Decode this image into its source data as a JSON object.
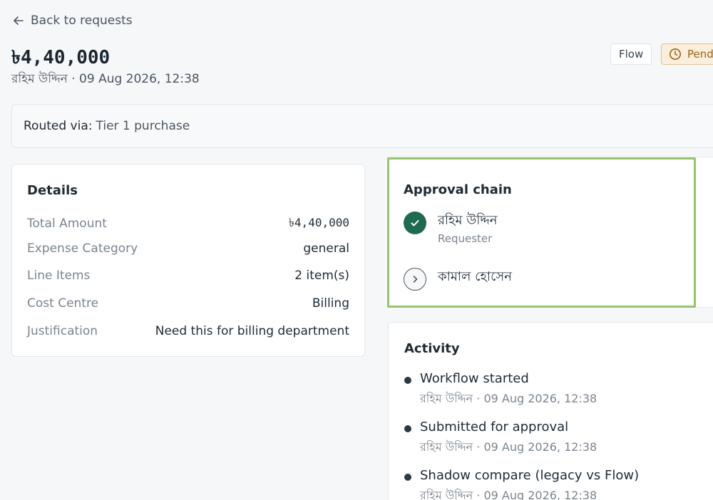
{
  "nav": {
    "back_label": "Back to requests"
  },
  "header": {
    "amount": "৳4,40,000",
    "meta": "রহিম উদ্দিন · 09 Aug 2026, 12:38",
    "tags": {
      "flow": "Flow",
      "status": "Pend"
    }
  },
  "routing": {
    "label": "Routed via:",
    "value": "Tier 1 purchase"
  },
  "details": {
    "title": "Details",
    "rows": [
      {
        "label": "Total Amount",
        "value": "৳4,40,000"
      },
      {
        "label": "Expense Category",
        "value": "general"
      },
      {
        "label": "Line Items",
        "value": "2 item(s)"
      },
      {
        "label": "Cost Centre",
        "value": "Billing"
      },
      {
        "label": "Justification",
        "value": "Need this for billing department"
      }
    ]
  },
  "approval": {
    "title": "Approval chain",
    "steps": [
      {
        "name": "রহিম উদ্দিন",
        "role": "Requester",
        "state": "done",
        "icon": "check-icon"
      },
      {
        "name": "কামাল হোসেন",
        "role": "",
        "state": "next",
        "icon": "chevron-right-icon"
      }
    ]
  },
  "activity": {
    "title": "Activity",
    "items": [
      {
        "title": "Workflow started",
        "meta": "রহিম উদ্দিন · 09 Aug 2026, 12:38"
      },
      {
        "title": "Submitted for approval",
        "meta": "রহিম উদ্দিন · 09 Aug 2026, 12:38"
      },
      {
        "title": "Shadow compare (legacy vs Flow)",
        "meta": "রহিম উদ্দিন · 09 Aug 2026, 12:38"
      }
    ]
  },
  "colors": {
    "background": "#f6f7f9",
    "done_step": "#1e6b4f",
    "highlight": "#96c66b",
    "status_tag_bg": "#fbeedb",
    "status_tag_text": "#9a6416"
  }
}
